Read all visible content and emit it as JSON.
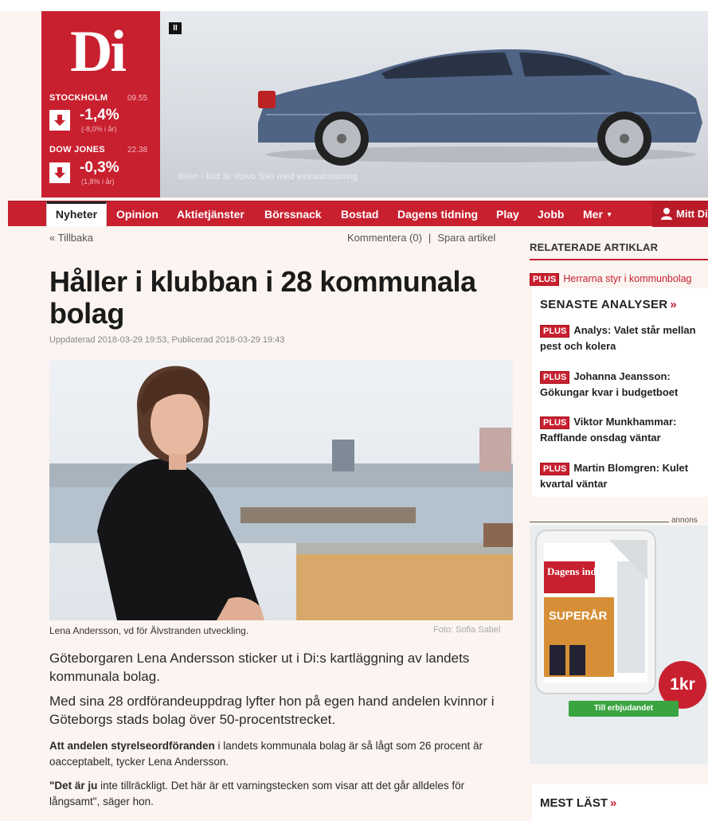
{
  "colors": {
    "brand_red": "#c8202f",
    "background": "#fbf4f0"
  },
  "header": {
    "logo": "Di",
    "ad_badge": "II",
    "ad_caption": "Bilen i bild är Volvo S90 med extrautrustning",
    "tickers": [
      {
        "name": "STOCKHOLM",
        "time": "09.55",
        "value": "-1,4%",
        "sub": "(-8,0% i år)",
        "direction": "down",
        "icon": "arrow-down-icon"
      },
      {
        "name": "DOW JONES",
        "time": "22.38",
        "value": "-0,3%",
        "sub": "(1,8% i år)",
        "direction": "down",
        "icon": "arrow-down-icon"
      }
    ]
  },
  "nav": {
    "items": [
      "Nyheter",
      "Opinion",
      "Aktietjänster",
      "Börssnack",
      "Bostad",
      "Dagens tidning",
      "Play",
      "Jobb",
      "Mer"
    ],
    "active": "Nyheter",
    "more_icon": "caret-down-icon",
    "user_label": "Mitt Di",
    "user_icon": "user-icon"
  },
  "article": {
    "back_label": "« Tillbaka",
    "comment_label": "Kommentera (0)",
    "separator": "|",
    "save_label": "Spara artikel",
    "headline": "Håller i klubban i 28 kommunala bolag",
    "dateline": "Uppdaterad 2018-03-29 19:53, Publicerad 2018-03-29 19:43",
    "photo_caption": "Lena Andersson, vd för Älvstranden utveckling.",
    "photo_credit": "Foto: Sofia Sabel",
    "lead_1": "Göteborgaren Lena Andersson sticker ut i Di:s kartläggning av landets kommunala bolag.",
    "lead_2": "Med sina 28 ordförandeuppdrag lyfter hon på egen hand andelen kvinnor i Göteborgs stads bolag över 50-procentstrecket.",
    "body_1_strong": "Att andelen styrelseordföranden",
    "body_1_rest": " i landets kommunala bolag är så lågt som 26 procent är oacceptabelt, tycker Lena Andersson.",
    "body_2_strong": "\"Det är ju",
    "body_2_rest": " inte tillräckligt. Det här är ett varningstecken som visar att det går alldeles för långsamt\", säger hon."
  },
  "sidebar": {
    "related_title": "RELATERADE ARTIKLAR",
    "related_link": {
      "badge": "PLUS",
      "text": "Herrarna styr i kommunbolag"
    },
    "analyser_title": "SENASTE ANALYSER",
    "chevron": "»",
    "analyser": [
      {
        "badge": "PLUS",
        "text": "Analys: Valet står mellan pest och kolera"
      },
      {
        "badge": "PLUS",
        "text": "Johanna Jeansson: Gökungar kvar i budgetboet"
      },
      {
        "badge": "PLUS",
        "text": "Viktor Munkhammar: Rafflande onsdag väntar"
      },
      {
        "badge": "PLUS",
        "text": "Martin Blomgren: Kulet kvartal väntar"
      }
    ],
    "ad_label": "annons",
    "ad_paper_title": "Dagens industri",
    "ad_paper_headline": "SUPERÅR",
    "ad_price": "1kr",
    "ad_button": "Till erbjudandet",
    "mest_title": "MEST LÄST"
  }
}
